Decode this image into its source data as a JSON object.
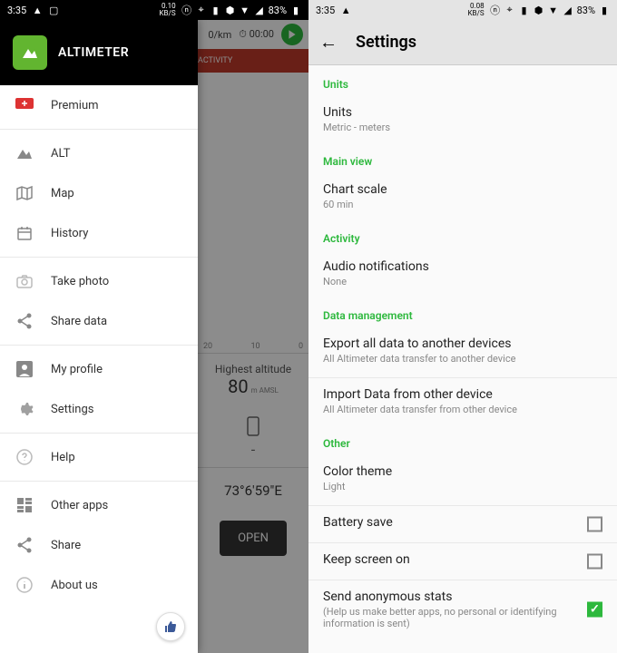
{
  "status": {
    "time": "3:35",
    "data_rate_1": "0.10",
    "data_rate_2": "0.08",
    "data_unit": "KB/S",
    "battery": "83%"
  },
  "drawer": {
    "app_name": "ALTIMETER",
    "items": {
      "premium": "Premium",
      "alt": "ALT",
      "map": "Map",
      "history": "History",
      "photo": "Take photo",
      "share_data": "Share data",
      "profile": "My profile",
      "settings": "Settings",
      "help": "Help",
      "other_apps": "Other apps",
      "share": "Share",
      "about": "About us"
    }
  },
  "main": {
    "pace": "0/km",
    "timer": "00:00",
    "tab": "ACTIVITY",
    "chart_ticks": {
      "a": "20",
      "b": "10",
      "c": "0"
    },
    "highest_label": "Highest altitude",
    "highest_value": "80",
    "highest_unit": "m AMSL",
    "device_value": "-",
    "coord": "73°6'59\"E",
    "open": "OPEN"
  },
  "settings": {
    "title": "Settings",
    "sections": {
      "units": {
        "header": "Units",
        "item_title": "Units",
        "item_sub": "Metric - meters"
      },
      "mainview": {
        "header": "Main view",
        "item_title": "Chart scale",
        "item_sub": "60 min"
      },
      "activity": {
        "header": "Activity",
        "item_title": "Audio notifications",
        "item_sub": "None"
      },
      "data": {
        "header": "Data management",
        "export_title": "Export all data to another devices",
        "export_sub": "All Altimeter data transfer to another device",
        "import_title": "Import Data from other device",
        "import_sub": "All Altimeter data transfer from other device"
      },
      "other": {
        "header": "Other",
        "color_title": "Color theme",
        "color_sub": "Light",
        "battery": "Battery save",
        "screen": "Keep screen on",
        "stats_title": "Send anonymous stats",
        "stats_sub": "(Help us make better apps, no personal or identifying information is sent)"
      }
    }
  }
}
